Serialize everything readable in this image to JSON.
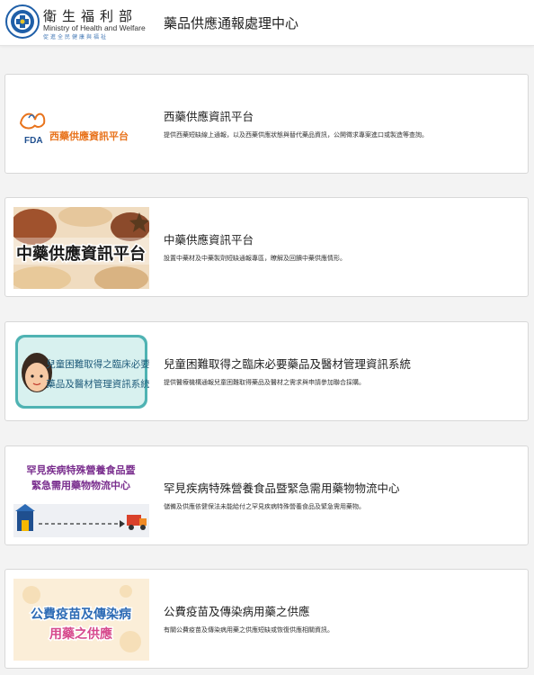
{
  "header": {
    "ministry_zh": "衛生福利部",
    "ministry_en": "Ministry of Health and Welfare",
    "ministry_slogan": "促進全民健康與福祉",
    "site_title": "藥品供應通報處理中心"
  },
  "colors": {
    "seal_blue": "#1f5fa8",
    "fda_orange": "#e8731c",
    "teal": "#3aa6a6",
    "purple": "#7a2e8e",
    "pink": "#d6488c"
  },
  "cards": [
    {
      "title": "西藥供應資訊平台",
      "desc": "提供西藥短缺線上通報，以及西藥供應狀態與替代藥品資訊，公開徵求專案進口或製造等查詢。",
      "image": {
        "fda_label": "FDA",
        "brand": "西藥供應資訊平台"
      }
    },
    {
      "title": "中藥供應資訊平台",
      "desc": "設置中藥材及中藥製劑短缺通報專區，瞭解及回饋中藥供應情形。",
      "image": {
        "banner": "中藥供應資訊平台"
      }
    },
    {
      "title": "兒童困難取得之臨床必要藥品及醫材管理資訊系統",
      "desc": "提供醫療機構通報兒童困難取得藥品及醫材之需求與申請參加聯合採購。",
      "image": {
        "line1": "兒童困難取得之臨床必要",
        "line2": "藥品及醫材管理資訊系統"
      }
    },
    {
      "title": "罕見疾病特殊營養食品暨緊急需用藥物物流中心",
      "desc": "儲備及供應依健保法未能給付之罕見疾病特殊營養食品及緊急需用藥物。",
      "image": {
        "line1": "罕見疾病特殊營養食品暨",
        "line2": "緊急需用藥物物流中心"
      }
    },
    {
      "title": "公費疫苗及傳染病用藥之供應",
      "desc": "有關公費疫苗及傳染病用藥之供應短缺或恢復供應相關資訊。",
      "image": {
        "line1": "公費疫苗及傳染病",
        "line2": "用藥之供應"
      }
    }
  ]
}
